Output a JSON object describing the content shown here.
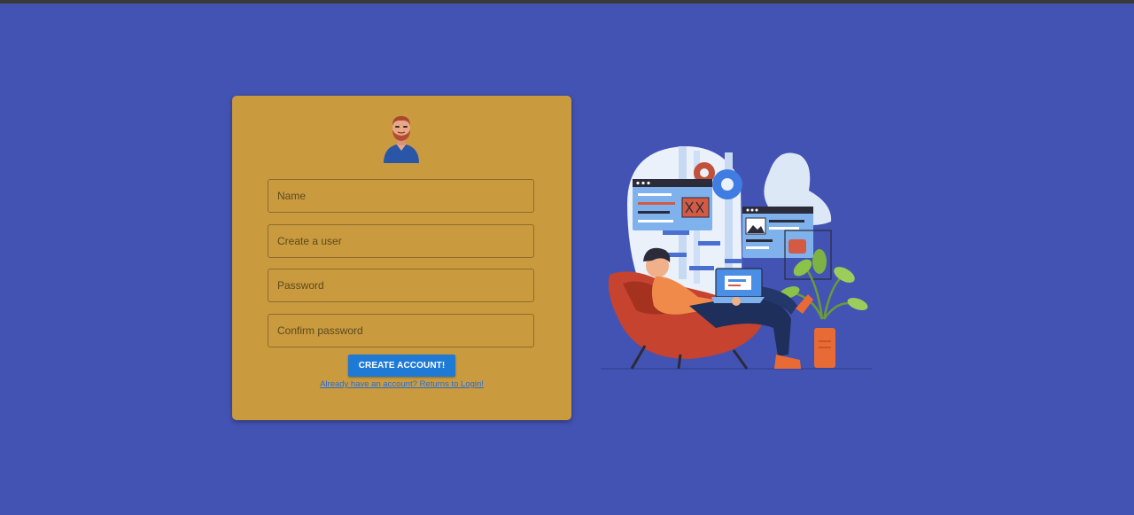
{
  "form": {
    "name_placeholder": "Name",
    "user_placeholder": "Create a user",
    "password_placeholder": "Password",
    "confirm_placeholder": "Confirm password",
    "submit_label": "CREATE ACCOUNT!",
    "login_link": "Already have an account? Returns to Login!"
  },
  "icons": {
    "avatar": "user-avatar-icon",
    "illustration": "person-working-on-laptop-illustration"
  },
  "colors": {
    "page_background": "#4353b3",
    "card_background": "#c99a3e",
    "button": "#1f7ad6",
    "link": "#2a6fd8"
  }
}
